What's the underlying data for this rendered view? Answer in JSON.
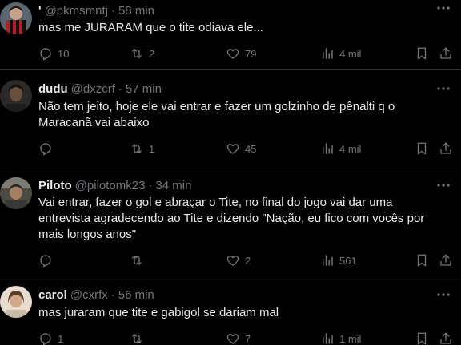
{
  "posts": [
    {
      "name": "'",
      "handle": "@pkmsmntj",
      "time": "58 min",
      "lines": [
        "mas me JURARAM que o tite odiava ele..."
      ],
      "replies": "10",
      "reposts": "2",
      "likes": "79",
      "views": "4 mil",
      "avatar_color": "#b3202a"
    },
    {
      "name": "dudu",
      "handle": "@dxzcrf",
      "time": "57 min",
      "lines": [
        "Não tem jeito, hoje ele vai entrar e fazer um golzinho de pênalti q o",
        "Maracanã vai abaixo"
      ],
      "replies": "",
      "reposts": "1",
      "likes": "45",
      "views": "4 mil",
      "avatar_color": "#3a3633"
    },
    {
      "name": "Piloto",
      "handle": "@pilotomk23",
      "time": "34 min",
      "lines": [
        "Vai entrar, fazer o gol e abraçar o Tite, no final do jogo vai dar uma",
        "entrevista agradecendo ao Tite e dizendo \"Nação, eu fico com vocês por",
        "mais longos anos\""
      ],
      "replies": "",
      "reposts": "",
      "likes": "2",
      "views": "561",
      "avatar_color": "#6b5a4a"
    },
    {
      "name": "carol",
      "handle": "@cxrfx",
      "time": "56 min",
      "lines": [
        "mas juraram que tite e gabigol se dariam mal"
      ],
      "replies": "1",
      "reposts": "",
      "likes": "7",
      "views": "1 mil",
      "avatar_color": "#d9c9b8"
    }
  ],
  "icons": {
    "reply": "reply-icon",
    "repost": "repost-icon",
    "like": "like-icon",
    "views": "views-icon",
    "bookmark": "bookmark-icon",
    "share": "share-icon",
    "more": "more-icon"
  },
  "colors": {
    "background": "#000000",
    "text": "#e7e9ea",
    "muted": "#71767b",
    "divider": "#2f3336"
  }
}
